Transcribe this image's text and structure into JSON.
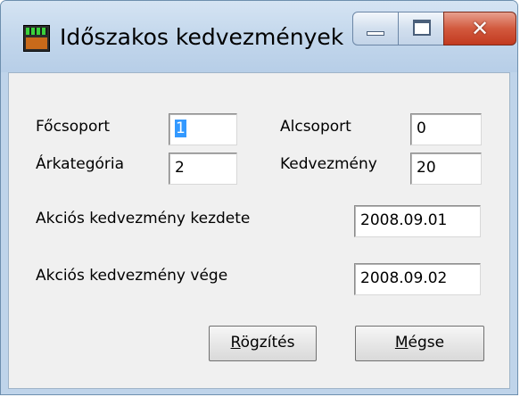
{
  "window": {
    "title": "Időszakos kedvezmények",
    "controls": {
      "minimize": "minimize",
      "maximize": "maximize",
      "close": "close"
    }
  },
  "form": {
    "focsoport_label": "Főcsoport",
    "focsoport_value": "1",
    "alcsoport_label": "Alcsoport",
    "alcsoport_value": "0",
    "arkategoria_label": "Árkategória",
    "arkategoria_value": "2",
    "kedvezmeny_label": "Kedvezmény",
    "kedvezmeny_value": "20",
    "akcio_kezdete_label": "Akciós kedvezmény kezdete",
    "akcio_kezdete_value": "2008.09.01",
    "akcio_vege_label": "Akciós kedvezmény vége",
    "akcio_vege_value": "2008.09.02"
  },
  "buttons": {
    "save_accel": "R",
    "save_rest": "ögzítés",
    "cancel_accel": "M",
    "cancel_rest": "égse"
  }
}
